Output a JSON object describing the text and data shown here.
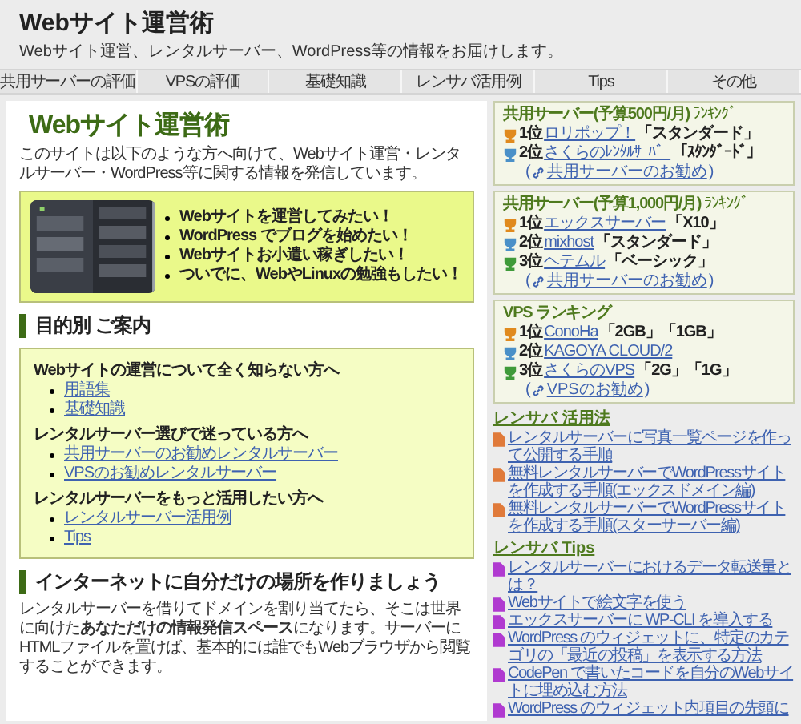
{
  "site": {
    "title": "Webサイト運営術",
    "tagline": "Webサイト運営、レンタルサーバー、WordPress等の情報をお届けします。"
  },
  "nav": [
    "共用サーバーの評価",
    "VPSの評価",
    "基礎知識",
    "レンサバ活用例",
    "Tips",
    "その他"
  ],
  "main": {
    "title": "Webサイト運営術",
    "intro": "このサイトは以下のような方へ向けて、Webサイト運営・レンタルサーバー・WordPress等に関する情報を発信しています。",
    "hero": {
      "kind": "picture",
      "bullets": [
        "Webサイトを運営してみたい！",
        "WordPress でブログを始めたい！",
        "Webサイトお小遣い稼ぎしたい！",
        "ついでに、WebやLinuxの勉強もしたい！"
      ]
    },
    "guide": {
      "heading": "目的別 ご案内",
      "groups": [
        {
          "title": "Webサイトの運営について全く知らない方へ",
          "links": [
            "用語集",
            "基礎知識"
          ]
        },
        {
          "title": "レンタルサーバー選びで迷っている方へ",
          "links": [
            "共用サーバーのお勧めレンタルサーバー",
            "VPSのお勧めレンタルサーバー"
          ]
        },
        {
          "title": "レンタルサーバーをもっと活用したい方へ",
          "links": [
            "レンタルサーバー活用例",
            "Tips"
          ]
        }
      ]
    },
    "section": {
      "heading": "インターネットに自分だけの場所を作りましょう",
      "paragraph": "レンタルサーバーを借りてドメインを割り当てたら、そこは世界に向けた**あなただけの情報発信スペース**になります。サーバーにHTMLファイルを置けば、基本的には誰でもWebブラウザから閲覧することができます。"
    }
  },
  "sidebar": [
    {
      "kind": "ranking",
      "title": "共用サーバー(予算500円/月)",
      "suffix": "ﾗﾝｷﾝｸﾞ",
      "items": [
        {
          "rank": "1位",
          "color": "#e08a1e",
          "name": "ロリポップ！",
          "plan": "「スタンダード」"
        },
        {
          "rank": "2位",
          "color": "#4a90c8",
          "name": "さくらのﾚﾝﾀﾙｻｰﾊﾞｰ",
          "plan": "「ｽﾀﾝﾀﾞｰﾄﾞ」"
        }
      ],
      "more": "共用サーバーのお勧め"
    },
    {
      "kind": "ranking",
      "title": "共用サーバー(予算1,000円/月)",
      "suffix": "ﾗﾝｷﾝｸﾞ",
      "items": [
        {
          "rank": "1位",
          "color": "#e08a1e",
          "name": "エックスサーバー",
          "plan": "「X10」"
        },
        {
          "rank": "2位",
          "color": "#4a90c8",
          "name": "mixhost",
          "plan": "「スタンダード」"
        },
        {
          "rank": "3位",
          "color": "#3f9a3a",
          "name": "ヘテムル",
          "plan": "「ベーシック」"
        }
      ],
      "more": "共用サーバーのお勧め"
    },
    {
      "kind": "ranking",
      "title": "VPS ランキング",
      "items": [
        {
          "rank": "1位",
          "color": "#e08a1e",
          "name": "ConoHa",
          "plan": "「2GB」「1GB」"
        },
        {
          "rank": "2位",
          "color": "#4a90c8",
          "name": "KAGOYA CLOUD/2"
        },
        {
          "rank": "3位",
          "color": "#3f9a3a",
          "name": "さくらのVPS",
          "plan": "「2G」「1G」"
        }
      ],
      "more": "VPSのお勧め"
    },
    {
      "kind": "posts",
      "title": "レンサバ 活用法",
      "color": "#e07a3a",
      "posts": [
        "レンタルサーバーに写真一覧ページを作って公開する手順",
        "無料レンタルサーバーでWordPressサイトを作成する手順(エックスドメイン編)",
        "無料レンタルサーバーでWordPressサイトを作成する手順(スターサーバー編)"
      ]
    },
    {
      "kind": "posts",
      "title": "レンサバ Tips",
      "color": "#b03ad0",
      "posts": [
        "レンタルサーバーにおけるデータ転送量とは？",
        "Webサイトで絵文字を使う",
        "エックスサーバーに WP-CLI を導入する",
        "WordPress のウィジェットに、特定のカテゴリの「最近の投稿」を表示する方法",
        "CodePen で書いたコードを自分のWebサイトに埋め込む方法",
        "WordPress のウィジェット内項目の先頭に"
      ]
    }
  ],
  "paren": {
    "open": "(",
    "close": ")"
  }
}
